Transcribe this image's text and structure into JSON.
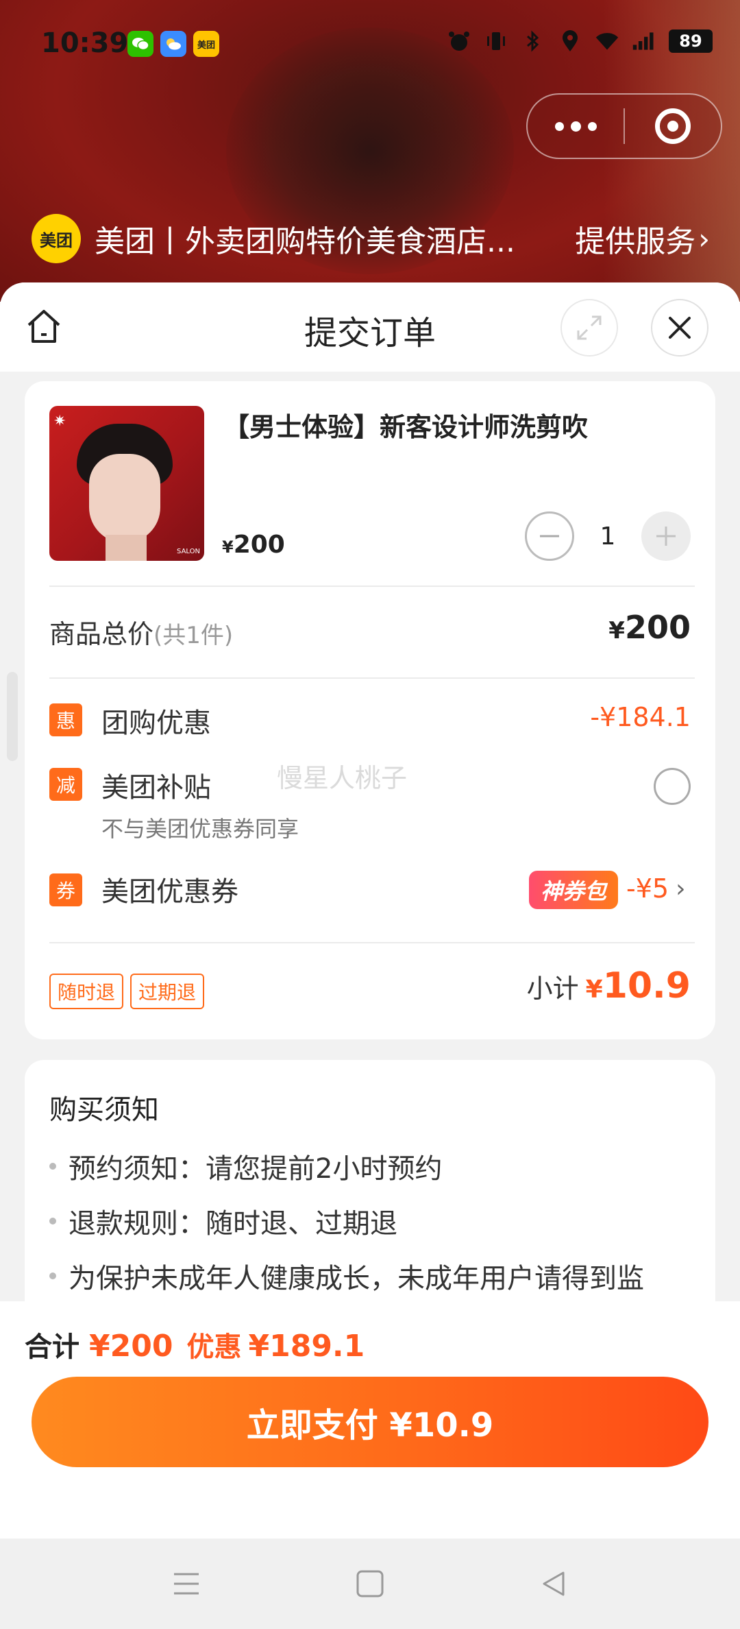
{
  "status_bar": {
    "time": "10:39",
    "app_badges": [
      {
        "name": "wechat-icon",
        "label": "",
        "color": "#2dc100"
      },
      {
        "name": "weather-icon",
        "label": "",
        "color": "#3b8cff"
      },
      {
        "name": "meituan-app-icon",
        "label": "美团",
        "color": "#ffc300"
      }
    ],
    "battery": "89"
  },
  "service": {
    "logo_text": "美团",
    "title": "美团丨外卖团购特价美食酒店...",
    "link": "提供服务"
  },
  "sheet": {
    "title": "提交订单"
  },
  "product": {
    "name": "【男士体验】新客设计师洗剪吹",
    "price_symbol": "¥",
    "price": "200",
    "quantity": "1",
    "image_brand": "SALON"
  },
  "summary": {
    "total_label": "商品总价",
    "total_count": "(共1件)",
    "total_symbol": "¥",
    "total_value": "200",
    "discounts": [
      {
        "tag": "惠",
        "label": "团购优惠",
        "value": "-¥184.1"
      },
      {
        "tag": "减",
        "label": "美团补贴",
        "sub": "不与美团优惠券同享"
      },
      {
        "tag": "券",
        "label": "美团优惠券",
        "pack": "神券包",
        "value": "-¥5"
      }
    ],
    "watermark": "慢星人桃子",
    "refund_tags": [
      "随时退",
      "过期退"
    ],
    "subtotal_label": "小计",
    "subtotal_symbol": "¥",
    "subtotal_value": "10.9"
  },
  "notice": {
    "title": "购买须知",
    "items": [
      "预约须知：请您提前2小时预约",
      "退款规则：随时退、过期退",
      "为保护未成年人健康成长，未成年用户请得到监"
    ]
  },
  "checkout": {
    "sum_label": "合计",
    "sum_value": "¥200",
    "discount_label": "优惠",
    "discount_value": "¥189.1",
    "pay_label": "立即支付 ¥10.9"
  },
  "colors": {
    "accent": "#ff5a1f",
    "tag_orange": "#ff6b1a",
    "pay_gradient_start": "#ff8a1f",
    "pay_gradient_end": "#ff4a16"
  }
}
